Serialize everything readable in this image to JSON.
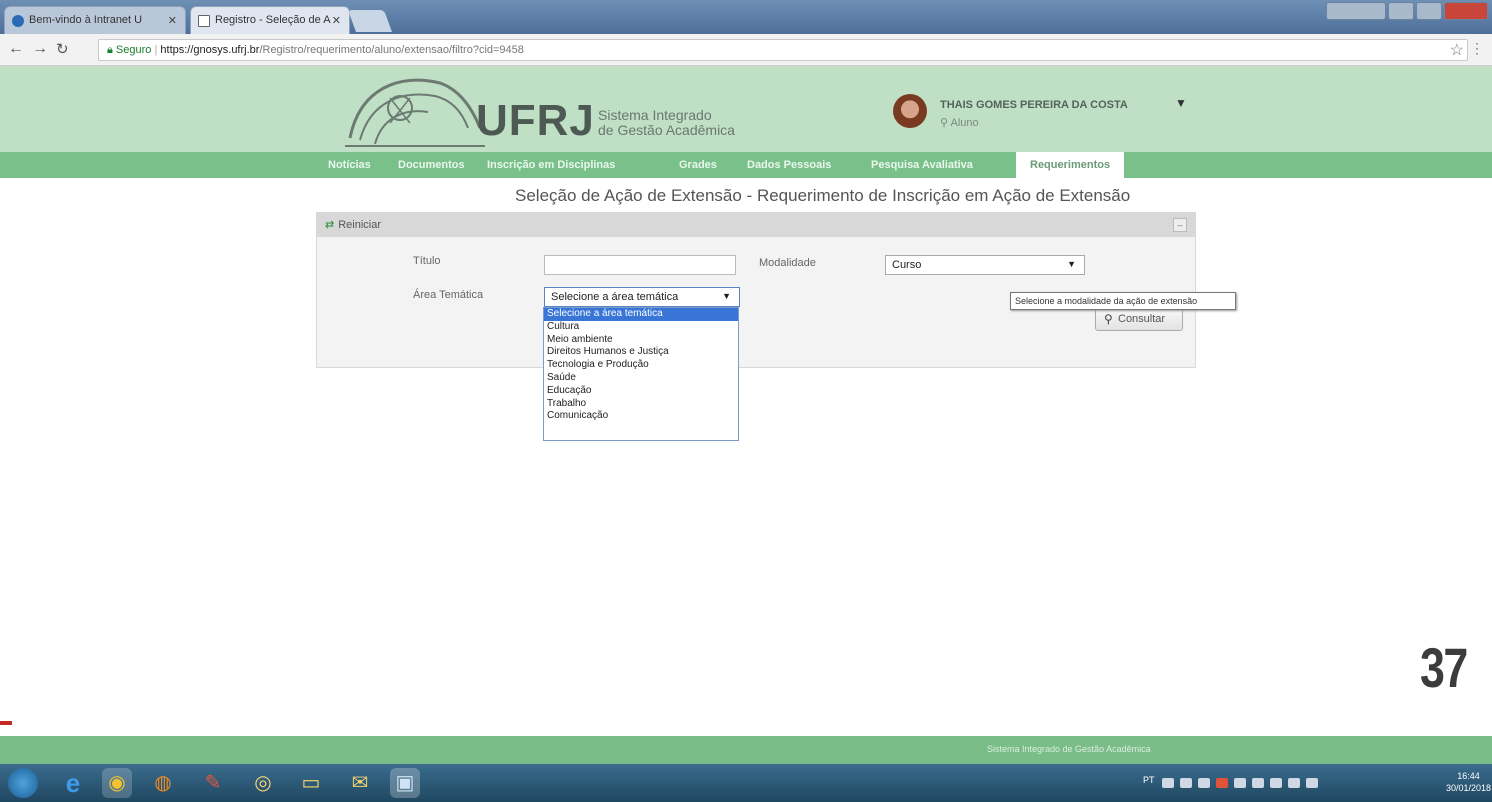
{
  "browser": {
    "tabs": [
      {
        "label": "Bem-vindo à Intranet U"
      },
      {
        "label": "Registro - Seleção de A"
      }
    ],
    "url": {
      "secure_label": "Seguro",
      "host": "https://gnosys.ufrj.br",
      "path": "/Registro/requerimento/aluno/extensao/filtro?cid=9458"
    }
  },
  "header": {
    "brand": "UFRJ",
    "brand_sub_line1": "Sistema Integrado",
    "brand_sub_line2": "de Gestão Acadêmica",
    "user_name": "THAIS GOMES PEREIRA DA COSTA",
    "user_role": "Aluno"
  },
  "nav": {
    "items": [
      {
        "label": "Notícias"
      },
      {
        "label": "Documentos"
      },
      {
        "label": "Inscrição em Disciplinas"
      },
      {
        "label": "Grades"
      },
      {
        "label": "Dados Pessoais"
      },
      {
        "label": "Pesquisa Avaliativa"
      },
      {
        "label": "Requerimentos"
      }
    ]
  },
  "page": {
    "title": "Seleção de Ação de Extensão - Requerimento de Inscrição em Ação de Extensão"
  },
  "filter": {
    "reset_label": "Reiniciar",
    "titulo_label": "Título",
    "titulo_value": "",
    "modalidade_label": "Modalidade",
    "modalidade_value": "Curso",
    "area_label": "Área Temática",
    "area_value": "Selecione a área temática",
    "area_options": [
      "Selecione a área temática",
      "Cultura",
      "Meio ambiente",
      "Direitos Humanos e Justiça",
      "Tecnologia e Produção",
      "Saúde",
      "Educação",
      "Trabalho",
      "Comunicação"
    ],
    "tooltip": "Selecione a modalidade da ação de extensão",
    "consult_label": "Consultar"
  },
  "slide_number": "37",
  "footer_text": "Sistema Integrado de Gestão Acadêmica",
  "taskbar": {
    "tray_lang": "PT",
    "clock_time": "16:44",
    "clock_date": "30/01/2018"
  },
  "colors": {
    "header_bg": "#bfe0c4",
    "nav_bg": "#79c08a",
    "footer_bg": "#7bbd88",
    "selected_option": "#3875d7"
  }
}
